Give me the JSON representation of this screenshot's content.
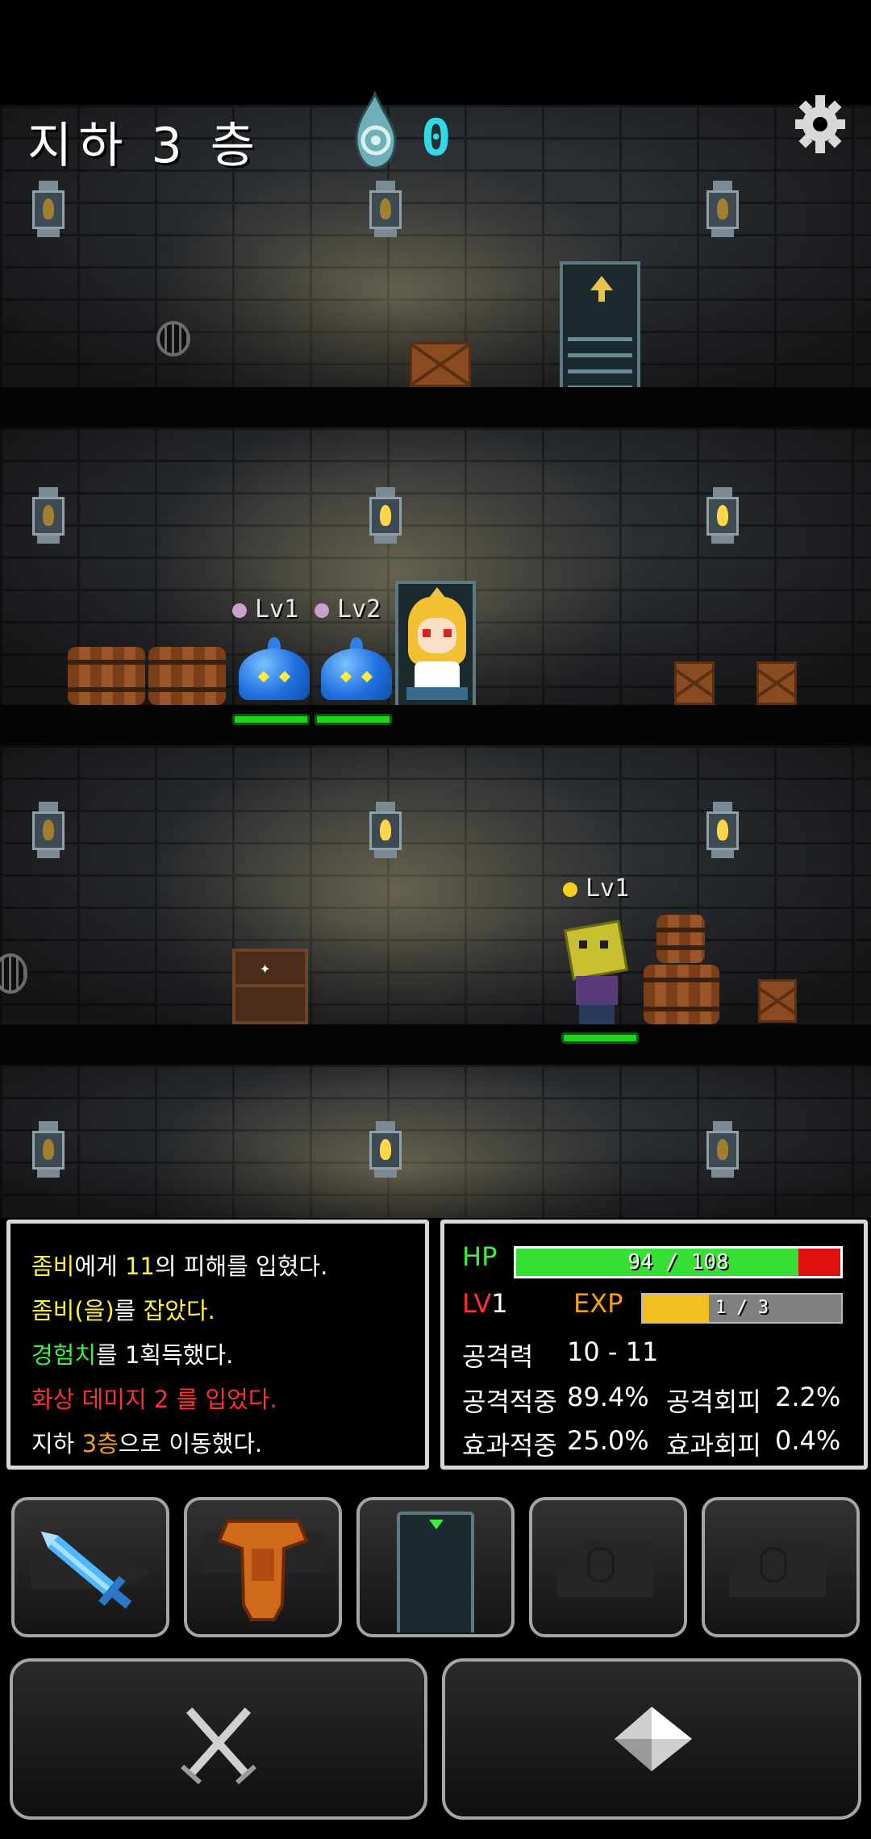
{
  "header": {
    "floor_title": "지하 3 층",
    "soul_count": "0",
    "settings_icon": "gear-icon"
  },
  "scene": {
    "slime_1_level": "Lv1",
    "slime_2_level": "Lv2",
    "zombie_level": "Lv1",
    "slime_1_hp_fraction": 1.0,
    "slime_2_hp_fraction": 1.0,
    "zombie_hp_fraction": 1.0
  },
  "log": {
    "line1": {
      "a": "좀비",
      "b": "에게 ",
      "c": "11",
      "d": "의 피해를 입혔다."
    },
    "line2": {
      "a": "좀비(을)",
      "b": "를 ",
      "c": "잡았다."
    },
    "line3": {
      "a": "경험치",
      "b": "를 1획득했다."
    },
    "line4": "화상 데미지 2 를 입었다.",
    "line5": {
      "a": "지하 ",
      "b": "3층",
      "c": "으로 이동했다."
    }
  },
  "stats": {
    "hp_label": "HP",
    "hp_text": "94 / 108",
    "hp_current": 94,
    "hp_max": 108,
    "lv_label": "LV",
    "lv_value": "1",
    "exp_label": "EXP",
    "exp_text": "1 / 3",
    "exp_current": 1,
    "exp_max": 3,
    "attack_label": "공격력",
    "attack_value": "10 - 11",
    "hit_label": "공격적중",
    "hit_value": "89.4%",
    "evade_label": "공격회피",
    "evade_value": "2.2%",
    "effect_hit_label": "효과적중",
    "effect_hit_value": "25.0%",
    "effect_evade_label": "효과회피",
    "effect_evade_value": "0.4%"
  },
  "slots": [
    "weapon-sword-icon",
    "armor-icon",
    "door-icon",
    "empty-slot-icon",
    "empty-slot-icon"
  ],
  "actions": [
    "attack-swords-icon",
    "move-arrow-icon"
  ],
  "colors": {
    "hp": "#33e033",
    "hp_missing": "#e01010",
    "exp": "#f0c020",
    "soul": "#31d9e8"
  }
}
